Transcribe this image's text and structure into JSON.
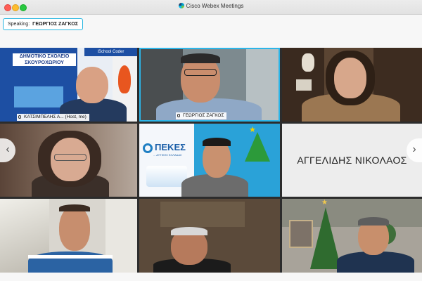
{
  "window": {
    "title": "Cisco Webex Meetings"
  },
  "speaking": {
    "label": "Speaking:",
    "name": "ΓΕΩΡΓΙΟΣ ΖΑΓΚΟΣ"
  },
  "participants": [
    {
      "label": "ΚΑΤΣΙΜΠΕΛΗΣ Α... (Host, me)",
      "sign_line1": "ΔΗΜΟΤΙΚΟ ΣΧΟΛΕΙΟ",
      "sign_line2": "ΣΚΟΥΡΟΧΩΡΙΟΥ",
      "banner": "iSchool Coder"
    },
    {
      "label": "ΓΕΩΡΓΙΟΣ ΖΑΓΚΟΣ",
      "active": true
    },
    {
      "label": ""
    },
    {
      "label": ""
    },
    {
      "label": "",
      "logo_text": "ΠΕΚΕΣ",
      "logo_sub": "... ΔΥΤΙΚΗΣ ΕΛΛΑΔΑΣ"
    },
    {
      "label": "",
      "name_display": "ΑΓΓΕΛΙΔΗΣ ΝΙΚΟΛΑΟΣ"
    },
    {
      "label": ""
    },
    {
      "label": ""
    },
    {
      "label": ""
    }
  ],
  "navigation": {
    "prev_icon": "‹",
    "next_icon": "›"
  },
  "colors": {
    "active_border": "#2cb5e8",
    "speaking_border": "#24b5e0"
  }
}
